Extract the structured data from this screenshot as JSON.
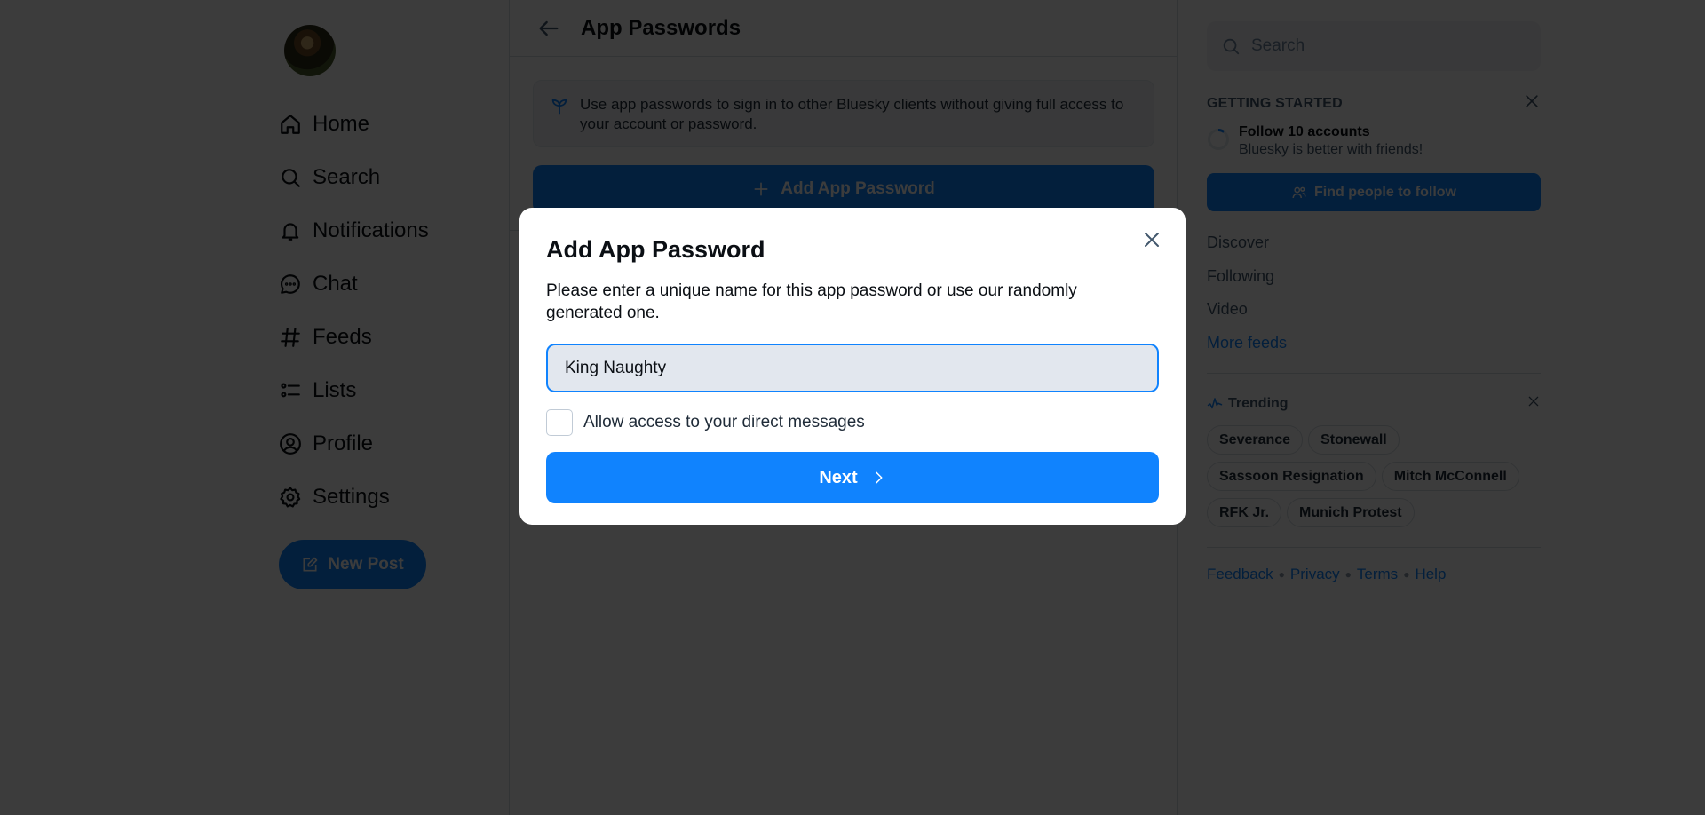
{
  "left_nav": {
    "avatar_alt": "User avatar",
    "items": [
      {
        "label": "Home",
        "icon": "home-icon"
      },
      {
        "label": "Search",
        "icon": "search-icon"
      },
      {
        "label": "Notifications",
        "icon": "bell-icon"
      },
      {
        "label": "Chat",
        "icon": "chat-bubble-icon"
      },
      {
        "label": "Feeds",
        "icon": "hashtag-icon"
      },
      {
        "label": "Lists",
        "icon": "list-icon"
      },
      {
        "label": "Profile",
        "icon": "user-circle-icon"
      },
      {
        "label": "Settings",
        "icon": "gear-icon"
      }
    ],
    "new_post_label": "New Post"
  },
  "center": {
    "title": "App Passwords",
    "info_text": "Use app passwords to sign in to other Bluesky clients without giving full access to your account or password.",
    "add_button_label": "Add App Password"
  },
  "right": {
    "search_placeholder": "Search",
    "getting_started": {
      "title": "GETTING STARTED",
      "task_title": "Follow 10 accounts",
      "task_subtitle": "Bluesky is better with friends!",
      "task_progress": 0.1,
      "button_label": "Find people to follow"
    },
    "feeds": [
      "Discover",
      "Following",
      "Video"
    ],
    "more_feeds_label": "More feeds",
    "trending": {
      "title": "Trending",
      "topics": [
        "Severance",
        "Stonewall",
        "Sassoon Resignation",
        "Mitch McConnell",
        "RFK Jr.",
        "Munich Protest"
      ]
    },
    "footer_links": [
      "Feedback",
      "Privacy",
      "Terms",
      "Help"
    ]
  },
  "modal": {
    "title": "Add App Password",
    "description": "Please enter a unique name for this app password or use our randomly generated one.",
    "name_value": "King Naughty",
    "checkbox_label": "Allow access to your direct messages",
    "checkbox_checked": false,
    "next_label": "Next"
  },
  "colors": {
    "accent": "#1083fe",
    "overlay": "#3c3f45"
  }
}
